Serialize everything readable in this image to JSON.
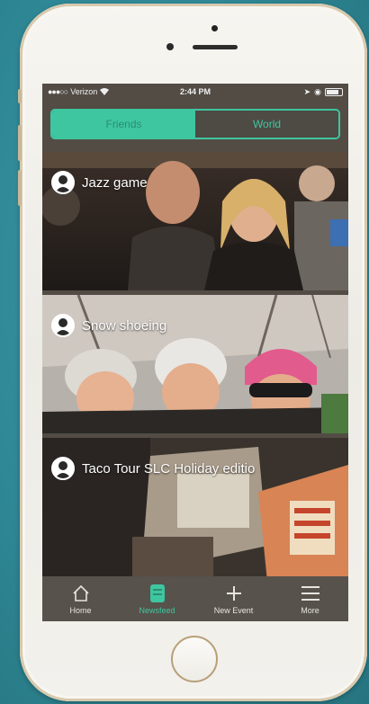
{
  "status_bar": {
    "carrier": "Verizon",
    "time": "2:44 PM"
  },
  "segment": {
    "tabs": [
      "Friends",
      "World"
    ],
    "active": "Friends"
  },
  "feed": {
    "items": [
      {
        "title": "Jazz game"
      },
      {
        "title": "Snow shoeing"
      },
      {
        "title": "Taco Tour SLC Holiday editio"
      }
    ]
  },
  "tab_bar": {
    "items": [
      {
        "label": "Home",
        "icon": "home-icon"
      },
      {
        "label": "Newsfeed",
        "icon": "newsfeed-icon"
      },
      {
        "label": "New Event",
        "icon": "plus-icon"
      },
      {
        "label": "More",
        "icon": "menu-icon"
      }
    ],
    "active": "Newsfeed"
  },
  "colors": {
    "accent": "#3ec6a0",
    "bar_bg": "#57524b",
    "background": "#2f8896"
  }
}
